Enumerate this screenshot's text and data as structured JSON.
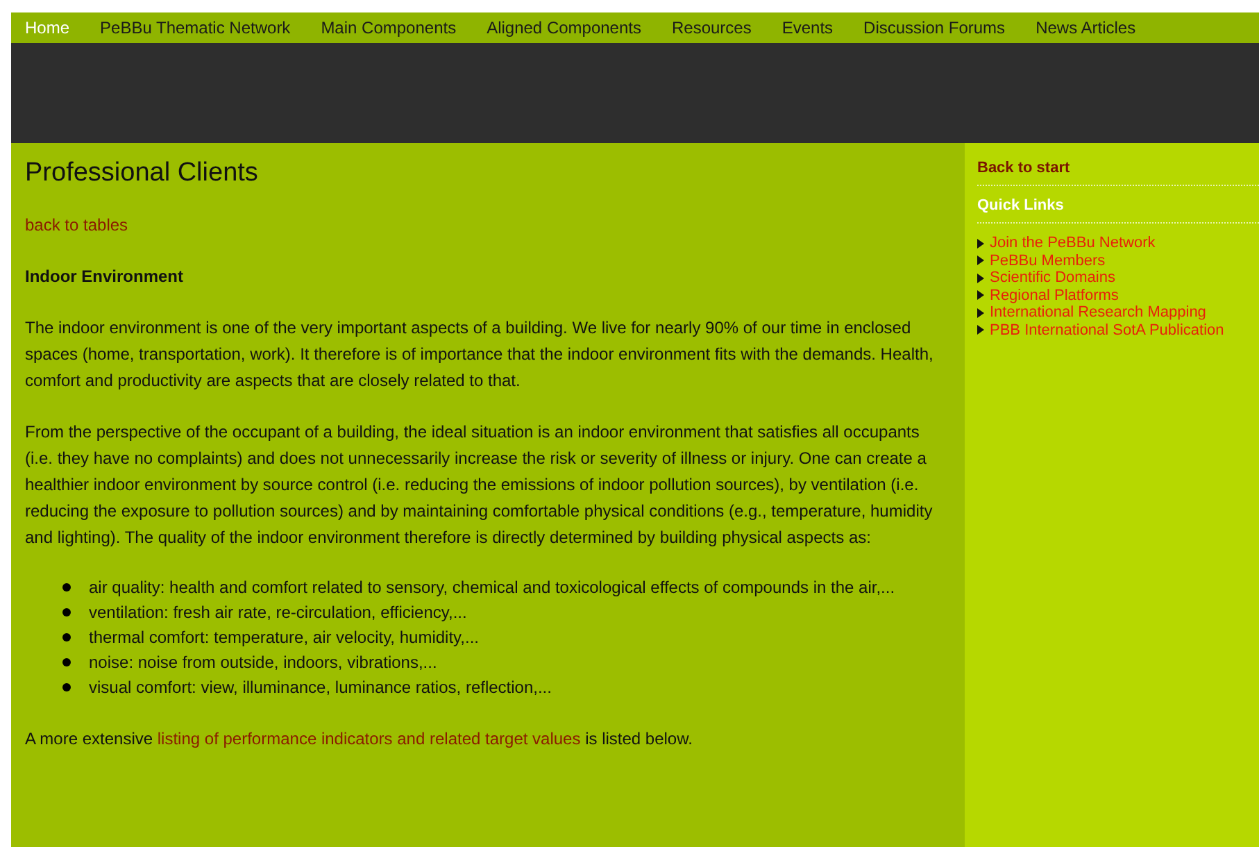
{
  "nav": [
    {
      "label": "Home",
      "selected": true
    },
    {
      "label": "PeBBu Thematic Network",
      "selected": false
    },
    {
      "label": "Main Components",
      "selected": false
    },
    {
      "label": "Aligned Components",
      "selected": false
    },
    {
      "label": "Resources",
      "selected": false
    },
    {
      "label": "Events",
      "selected": false
    },
    {
      "label": "Discussion Forums",
      "selected": false
    },
    {
      "label": "News Articles",
      "selected": false
    }
  ],
  "main": {
    "title": "Professional Clients",
    "back_link": "back to tables",
    "heading": "Indoor Environment",
    "paragraphs": [
      "The indoor environment is one of the very important aspects of a building. We live for nearly 90% of our time in enclosed spaces (home, transportation, work). It therefore is of importance that the indoor environment fits with the demands. Health, comfort and productivity are aspects that are closely related to that.",
      "From the perspective of the occupant of a building, the ideal situation is an indoor environment that satisfies all occupants (i.e. they have no complaints) and does not unnecessarily increase the risk or severity of illness or injury. One can create a healthier indoor environment by source control (i.e. reducing the emissions of indoor pollution sources), by ventilation (i.e. reducing the exposure to pollution sources) and by maintaining comfortable physical conditions (e.g., temperature, humidity and lighting). The quality of the indoor environment therefore is directly determined by building physical aspects as:"
    ],
    "bullets": [
      "air quality: health and comfort related to sensory, chemical and toxicological effects of compounds in the air,...",
      "ventilation: fresh air rate, re-circulation, efficiency,...",
      "thermal comfort: temperature, air velocity, humidity,...",
      "noise: noise from outside, indoors, vibrations,...",
      "visual comfort: view, illuminance, luminance ratios, reflection,..."
    ],
    "closing": {
      "before": "A more extensive ",
      "link": "listing of performance indicators and related target values",
      "after": " is listed below."
    }
  },
  "sidebar": {
    "back": "Back to start",
    "quick_links_title": "Quick Links",
    "links": [
      "Join the PeBBu Network",
      "PeBBu Members",
      "Scientific Domains",
      "Regional Platforms",
      "International Research Mapping",
      "PBB International SotA Publication"
    ]
  }
}
